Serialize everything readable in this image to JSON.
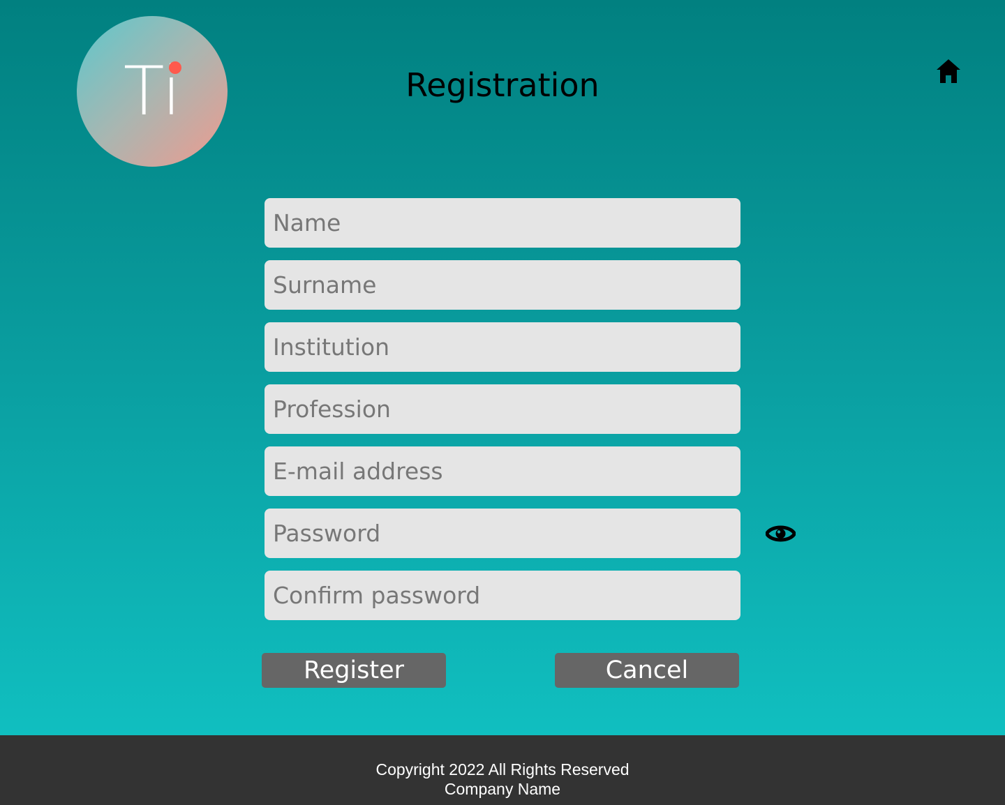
{
  "logo": {
    "text": "Ti",
    "dot_color": "#ff5a4d"
  },
  "header": {
    "title": "Registration",
    "home_icon": "home-icon"
  },
  "form": {
    "fields": [
      {
        "placeholder": "Name",
        "value": ""
      },
      {
        "placeholder": "Surname",
        "value": ""
      },
      {
        "placeholder": "Institution",
        "value": ""
      },
      {
        "placeholder": "Profession",
        "value": ""
      },
      {
        "placeholder": "E-mail address",
        "value": ""
      },
      {
        "placeholder": "Password",
        "value": ""
      },
      {
        "placeholder": "Confirm password",
        "value": ""
      }
    ],
    "password_toggle_icon": "eye-icon",
    "register_label": "Register",
    "cancel_label": "Cancel"
  },
  "footer": {
    "copyright": "Copyright 2022 All Rights Reserved",
    "company": "Company Name"
  },
  "colors": {
    "background_top": "#018080",
    "background_bottom": "#10bfc0",
    "field_background": "#e5e5e5",
    "button_background": "#666666",
    "footer_background": "#333333"
  }
}
